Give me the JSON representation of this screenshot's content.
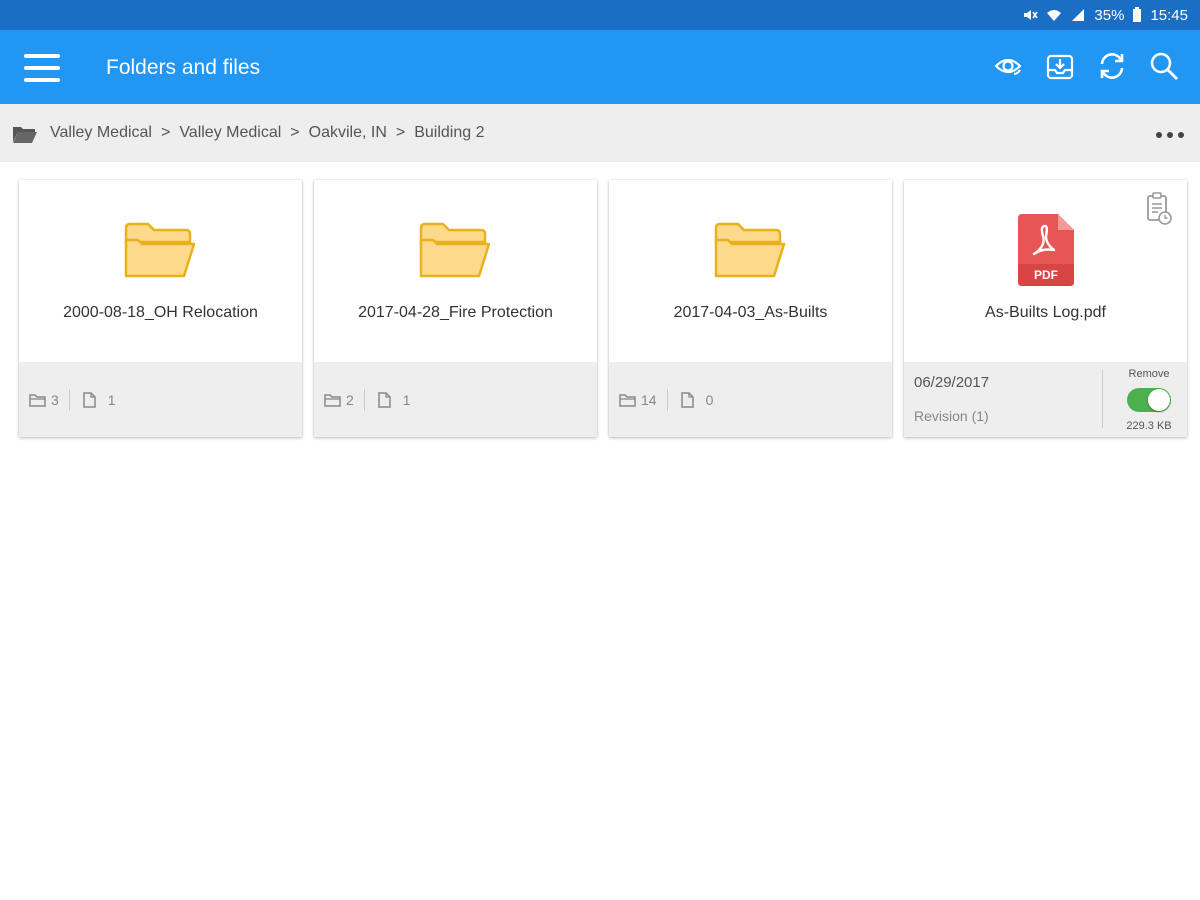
{
  "status_bar": {
    "battery": "35%",
    "time": "15:45"
  },
  "app_bar": {
    "title": "Folders and files",
    "actions": [
      "eye-sync-icon",
      "download-tray-icon",
      "sync-icon",
      "search-icon"
    ]
  },
  "breadcrumb": {
    "items": [
      "Valley Medical",
      "Valley Medical",
      "Oakvile, IN",
      "Building 2"
    ],
    "separator": ">"
  },
  "cards": [
    {
      "type": "folder",
      "name": "2000-08-18_OH Relocation",
      "folder_count": "3",
      "file_count": "1"
    },
    {
      "type": "folder",
      "name": "2017-04-28_Fire Protection",
      "folder_count": "2",
      "file_count": "1"
    },
    {
      "type": "folder",
      "name": "2017-04-03_As-Builts",
      "folder_count": "14",
      "file_count": "0"
    },
    {
      "type": "file",
      "name": "As-Builts Log.pdf",
      "date": "06/29/2017",
      "revision": "Revision  (1)",
      "remove_label": "Remove",
      "size": "229.3 KB",
      "pdf_badge": "PDF"
    }
  ],
  "colors": {
    "app_bar": "#2196f3",
    "status_bar": "#1a6fc4",
    "folder_fill": "#fcd98b",
    "folder_stroke": "#e8b21e",
    "pdf_red": "#e85555",
    "toggle_on": "#4caf50"
  }
}
